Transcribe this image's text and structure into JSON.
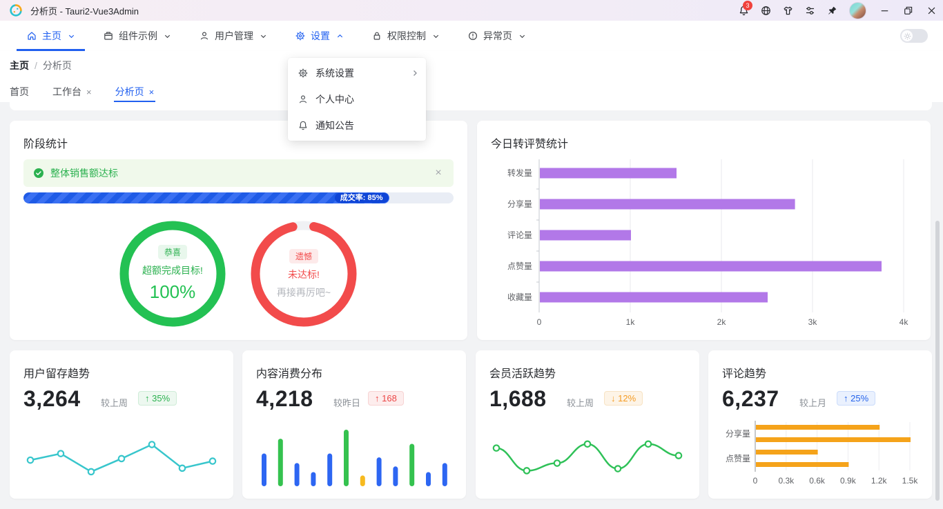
{
  "window": {
    "title": "分析页 - Tauri2-Vue3Admin",
    "notification_count": "3"
  },
  "nav": {
    "items": [
      {
        "label": "主页",
        "icon": "home-icon",
        "active": true
      },
      {
        "label": "组件示例",
        "icon": "components-icon"
      },
      {
        "label": "用户管理",
        "icon": "user-icon"
      },
      {
        "label": "设置",
        "icon": "gear-icon",
        "expanded": true
      },
      {
        "label": "权限控制",
        "icon": "lock-icon"
      },
      {
        "label": "异常页",
        "icon": "warning-icon"
      }
    ]
  },
  "breadcrumb": {
    "root": "主页",
    "separator": "/",
    "current": "分析页"
  },
  "tabs": [
    {
      "label": "首页",
      "closable": false
    },
    {
      "label": "工作台",
      "closable": true,
      "close": "×"
    },
    {
      "label": "分析页",
      "closable": true,
      "close": "×",
      "active": true
    }
  ],
  "settings_menu": {
    "items": [
      {
        "label": "系统设置",
        "icon": "gear-icon",
        "has_submenu": true
      },
      {
        "label": "个人中心",
        "icon": "user-icon",
        "has_submenu": false
      },
      {
        "label": "通知公告",
        "icon": "bell-icon",
        "has_submenu": false
      }
    ]
  },
  "stage_card": {
    "title": "阶段统计",
    "alert": {
      "text": "整体销售额达标",
      "icon": "check-circle-icon",
      "close": "×"
    },
    "progress": {
      "label": "成交率: 85%",
      "percent": 85
    },
    "rings": [
      {
        "badge": "恭喜",
        "line1": "超额完成目标!",
        "line2": "100%",
        "percent": 100,
        "color": "#23c153"
      },
      {
        "badge": "遗憾",
        "line1": "未达标!",
        "line2": "再接再厉吧~",
        "percent": 93,
        "color": "#f24b4b"
      }
    ]
  },
  "share_card": {
    "title": "今日转评赞统计"
  },
  "stat_cards": [
    {
      "title": "用户留存趋势",
      "value": "3,264",
      "compare": "较上周",
      "badge": {
        "arrow": "↑",
        "text": "35%",
        "type": "green"
      }
    },
    {
      "title": "内容消费分布",
      "value": "4,218",
      "compare": "较昨日",
      "badge": {
        "arrow": "↑",
        "text": "168",
        "type": "red"
      }
    },
    {
      "title": "会员活跃趋势",
      "value": "1,688",
      "compare": "较上周",
      "badge": {
        "arrow": "↓",
        "text": "12%",
        "type": "orange"
      }
    },
    {
      "title": "评论趋势",
      "value": "6,237",
      "compare": "较上月",
      "badge": {
        "arrow": "↑",
        "text": "25%",
        "type": "blue"
      }
    }
  ],
  "chart_data": [
    {
      "id": "share-stats",
      "type": "bar",
      "orientation": "horizontal",
      "title": "今日转评赞统计",
      "categories": [
        "转发量",
        "分享量",
        "评论量",
        "点赞量",
        "收藏量"
      ],
      "values": [
        1500,
        2800,
        1000,
        3750,
        2500
      ],
      "xlim": [
        0,
        4000
      ],
      "xticks": [
        "0",
        "1k",
        "2k",
        "3k",
        "4k"
      ],
      "color": "#b278e8",
      "grid": true,
      "legend": "none"
    },
    {
      "id": "retention",
      "type": "line",
      "title": "用户留存趋势",
      "values": [
        45,
        58,
        22,
        48,
        76,
        29,
        43
      ],
      "color": "#38c6cc",
      "smooth": false,
      "markers": true,
      "ylim": [
        0,
        100
      ]
    },
    {
      "id": "consumption",
      "type": "bar",
      "orientation": "vertical",
      "title": "内容消费分布",
      "values": [
        58,
        84,
        41,
        25,
        58,
        100,
        19,
        51,
        35,
        75,
        25,
        41
      ],
      "bar_colors": [
        "#2d66f2",
        "#35c24f",
        "#2d66f2",
        "#2d66f2",
        "#2d66f2",
        "#35c24f",
        "#f7ba1f",
        "#2d66f2",
        "#2d66f2",
        "#35c24f",
        "#2d66f2",
        "#2d66f2"
      ]
    },
    {
      "id": "member",
      "type": "line",
      "title": "会员活跃趋势",
      "values": [
        69,
        24,
        39,
        77,
        28,
        77,
        54
      ],
      "color": "#2fc158",
      "smooth": true,
      "markers": true,
      "ylim": [
        0,
        100
      ]
    },
    {
      "id": "comment",
      "type": "bar",
      "orientation": "horizontal",
      "title": "评论趋势",
      "categories": [
        "分享量",
        "点赞量"
      ],
      "series": [
        {
          "name": "series-1",
          "values": [
            1200,
            600
          ]
        },
        {
          "name": "series-2",
          "values": [
            1500,
            900
          ]
        }
      ],
      "xlim": [
        0,
        1500
      ],
      "xticks": [
        "0",
        "0.3k",
        "0.6k",
        "0.9k",
        "1.2k",
        "1.5k"
      ],
      "color": "#f5a31a",
      "grid": true
    }
  ],
  "icons": [
    "logo-icon",
    "bell-icon",
    "language-icon",
    "skin-icon",
    "layout-icon",
    "pin-icon",
    "minimize-icon",
    "maximize-icon",
    "close-icon",
    "home-icon",
    "components-icon",
    "user-icon",
    "gear-icon",
    "lock-icon",
    "warning-icon",
    "chevron-down-icon",
    "chevron-up-icon",
    "chevron-right-icon",
    "check-circle-icon",
    "sun-icon"
  ],
  "theme": {
    "accent": "#2160f0",
    "success": "#2bb14f",
    "danger": "#f24b4b",
    "warning": "#f59b22",
    "purple": "#b278e8",
    "teal": "#38c6cc",
    "orange_bar": "#f5a31a",
    "titlebar_bg": "#f4edf6"
  }
}
